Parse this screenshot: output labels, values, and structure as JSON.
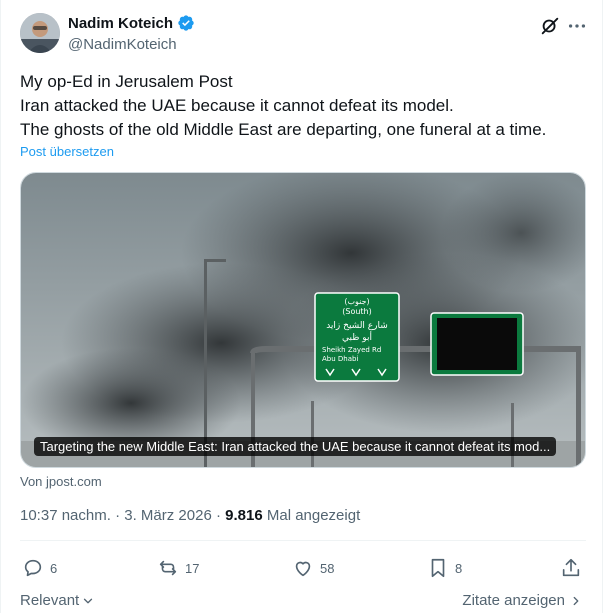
{
  "author": {
    "display_name": "Nadim Koteich",
    "handle": "@NadimKoteich",
    "verified": true
  },
  "post": {
    "lines": [
      "My op-Ed in Jerusalem Post",
      "Iran attacked the UAE because it cannot defeat its model.",
      "The ghosts of the old Middle East are departing, one funeral at a time."
    ],
    "translate_label": "Post übersetzen"
  },
  "card": {
    "caption": "Targeting the new Middle East: Iran attacked the UAE because it cannot defeat its mod...",
    "source": "Von jpost.com",
    "sign": {
      "arabic_top": "(جنوب)",
      "english_dir": "(South)",
      "arabic_road": "شارع الشيخ زايد",
      "arabic_city": "أبو ظبي",
      "english_road": "Sheikh Zayed Rd",
      "english_city": "Abu Dhabi"
    }
  },
  "meta": {
    "time": "10:37 nachm.",
    "separator": " · ",
    "date": "3. März 2026",
    "views_count": "9.816",
    "views_label": " Mal angezeigt"
  },
  "actions": {
    "replies": "6",
    "reposts": "17",
    "likes": "58",
    "bookmarks": "8"
  },
  "footer": {
    "relevant": "Relevant",
    "quotes": "Zitate anzeigen"
  },
  "colors": {
    "accent": "#1d9bf0",
    "secondary_text": "#536471",
    "sign_green": "#0b7a3e"
  },
  "icons": [
    "verified-badge-icon",
    "grok-icon",
    "more-icon",
    "reply-icon",
    "repost-icon",
    "like-icon",
    "bookmark-icon",
    "share-icon",
    "chevron-down-icon",
    "chevron-right-icon"
  ]
}
